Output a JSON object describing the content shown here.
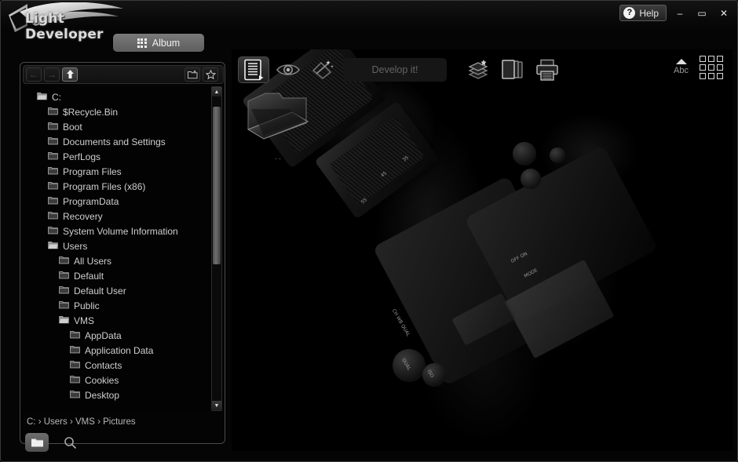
{
  "app": {
    "title": "Light Developer",
    "logo_icon": "wing-swoosh-logo"
  },
  "titlebar": {
    "help_label": "Help",
    "help_icon": "question-circle-icon",
    "minimize_icon": "minimize-icon",
    "maximize_icon": "maximize-icon",
    "close_icon": "close-icon",
    "minimize_glyph": "–",
    "maximize_glyph": "▭",
    "close_glyph": "✕"
  },
  "tabs": {
    "album": {
      "label": "Album",
      "icon": "grid-9-icon",
      "selected": true
    }
  },
  "browser": {
    "nav": {
      "back_icon": "arrow-left-icon",
      "back_glyph": "←",
      "back_enabled": false,
      "forward_icon": "arrow-right-icon",
      "forward_glyph": "→",
      "forward_enabled": false,
      "up_icon": "arrow-up-folder-icon",
      "up_glyph": "⬆",
      "up_enabled": true,
      "new_folder_icon": "new-folder-icon",
      "favorite_icon": "star-icon",
      "favorite_glyph": "☆"
    },
    "tree": [
      {
        "label": "C:",
        "depth": 0,
        "icon": "folder-open-icon"
      },
      {
        "label": "$Recycle.Bin",
        "depth": 1,
        "icon": "folder-icon"
      },
      {
        "label": "Boot",
        "depth": 1,
        "icon": "folder-icon"
      },
      {
        "label": "Documents and Settings",
        "depth": 1,
        "icon": "folder-icon"
      },
      {
        "label": "PerfLogs",
        "depth": 1,
        "icon": "folder-icon"
      },
      {
        "label": "Program Files",
        "depth": 1,
        "icon": "folder-icon"
      },
      {
        "label": "Program Files (x86)",
        "depth": 1,
        "icon": "folder-icon"
      },
      {
        "label": "ProgramData",
        "depth": 1,
        "icon": "folder-icon"
      },
      {
        "label": "Recovery",
        "depth": 1,
        "icon": "folder-icon"
      },
      {
        "label": "System Volume Information",
        "depth": 1,
        "icon": "folder-icon"
      },
      {
        "label": "Users",
        "depth": 1,
        "icon": "folder-open-icon"
      },
      {
        "label": "All Users",
        "depth": 2,
        "icon": "folder-icon"
      },
      {
        "label": "Default",
        "depth": 2,
        "icon": "folder-icon"
      },
      {
        "label": "Default User",
        "depth": 2,
        "icon": "folder-icon"
      },
      {
        "label": "Public",
        "depth": 2,
        "icon": "folder-icon"
      },
      {
        "label": "VMS",
        "depth": 2,
        "icon": "folder-open-icon"
      },
      {
        "label": "AppData",
        "depth": 3,
        "icon": "folder-icon"
      },
      {
        "label": "Application Data",
        "depth": 3,
        "icon": "folder-icon"
      },
      {
        "label": "Contacts",
        "depth": 3,
        "icon": "folder-icon"
      },
      {
        "label": "Cookies",
        "depth": 3,
        "icon": "folder-icon"
      },
      {
        "label": "Desktop",
        "depth": 3,
        "icon": "folder-icon"
      }
    ],
    "scrollbar": {
      "up_glyph": "▲",
      "down_glyph": "▼",
      "thumb_top_pct": 3,
      "thumb_height_pct": 52
    },
    "breadcrumb": "C: › Users › VMS › Pictures",
    "bottom": {
      "folder_view_icon": "folder-view-icon",
      "folder_view_active": true,
      "search_icon": "magnifier-icon"
    }
  },
  "toolbar": {
    "items": [
      {
        "name": "metadata-button",
        "icon": "document-list-icon",
        "selected": true
      },
      {
        "name": "preview-button",
        "icon": "eye-icon",
        "selected": false
      },
      {
        "name": "develop-wand-button",
        "icon": "magic-wand-icon",
        "selected": false
      }
    ],
    "develop_label": "Develop it!",
    "develop_enabled": false,
    "right_items": [
      {
        "name": "batch-button",
        "icon": "layers-star-icon"
      },
      {
        "name": "copy-button",
        "icon": "photo-stack-icon"
      },
      {
        "name": "print-button",
        "icon": "printer-icon"
      }
    ],
    "sort": {
      "label": "Abc",
      "direction_icon": "triangle-up-icon",
      "direction": "ascending"
    },
    "view": {
      "icon": "grid-view-icon"
    }
  },
  "content": {
    "items": [
      {
        "label": "..",
        "icon": "folder-3d-icon",
        "type": "parent-folder"
      }
    ],
    "background_image": "dark-dslr-camera-photo"
  },
  "colors": {
    "window_bg": "#050505",
    "panel_border": "#4a4a4a",
    "text_primary": "#cfcfcf",
    "text_dim": "#6a6a6a",
    "tab_active": "#6a6a6a"
  }
}
